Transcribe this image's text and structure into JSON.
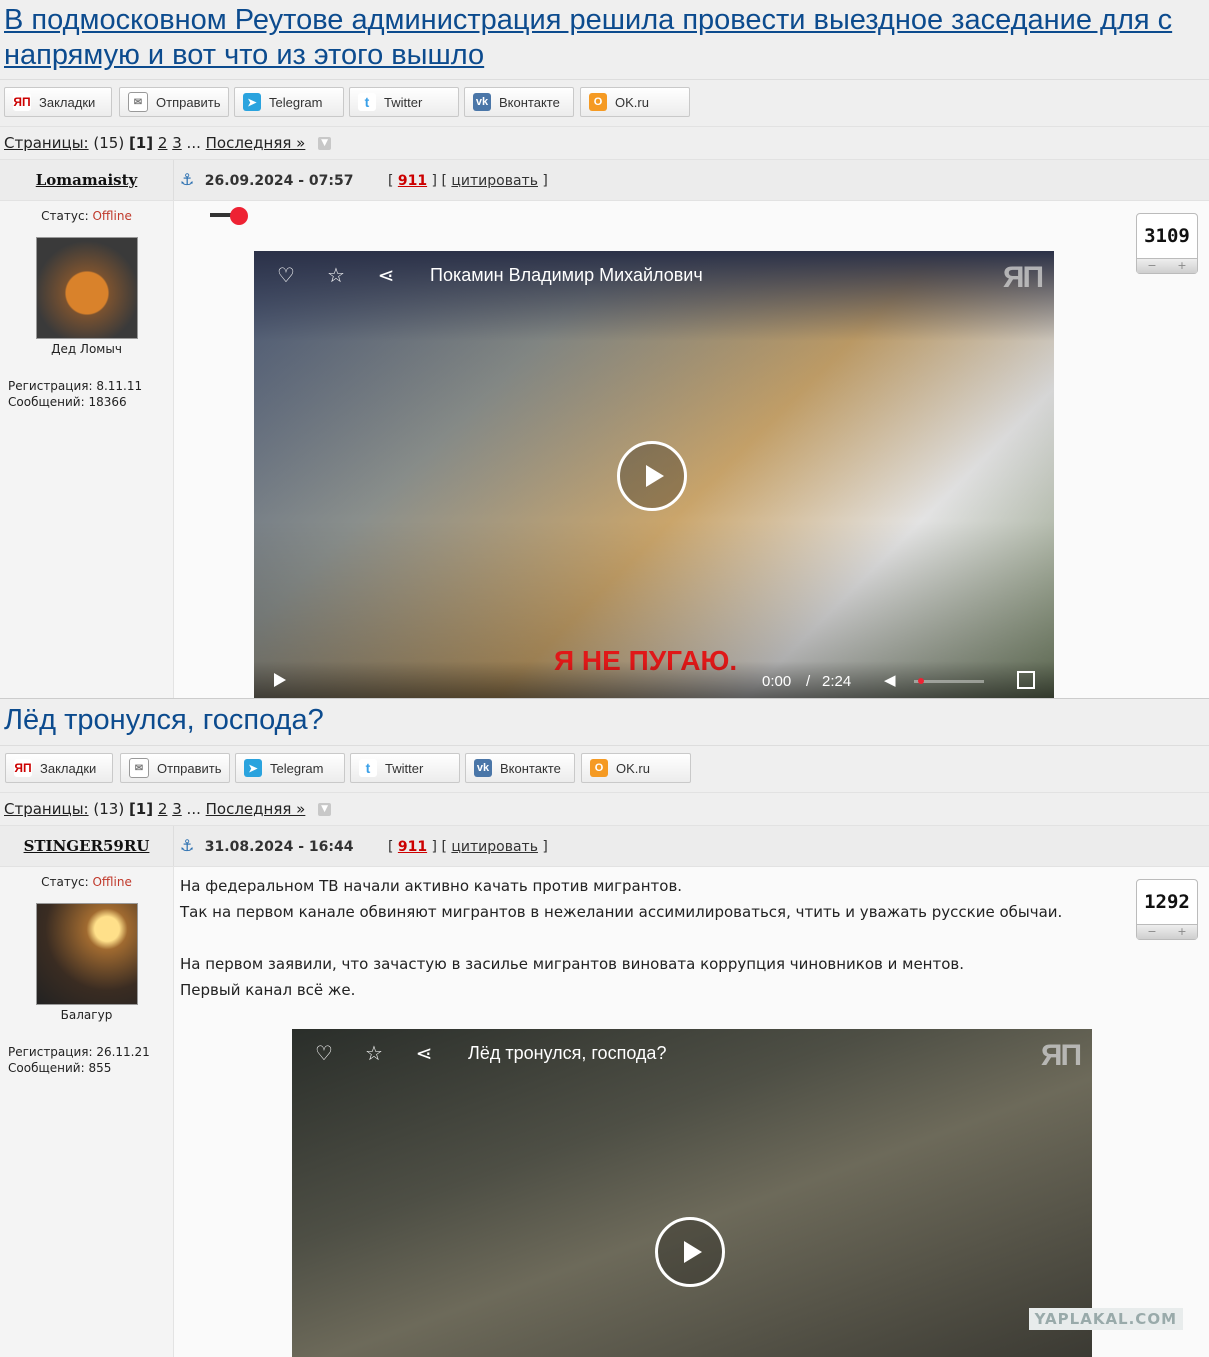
{
  "share_buttons": [
    {
      "label": "Закладки",
      "icon": "yp-bookmark-icon"
    },
    {
      "label": "Отправить",
      "icon": "mail-icon"
    },
    {
      "label": "Telegram",
      "icon": "telegram-icon"
    },
    {
      "label": "Twitter",
      "icon": "twitter-icon"
    },
    {
      "label": "Вконтакте",
      "icon": "vk-icon"
    },
    {
      "label": "OK.ru",
      "icon": "ok-icon"
    }
  ],
  "topics": [
    {
      "title": "В подмосковном Реутове администрация решила провести выездное заседание для с напрямую и вот что из этого вышло",
      "pages_label": "Страницы:",
      "pages_count": "(15)",
      "current_page": "[1]",
      "page_links": [
        "2",
        "3"
      ],
      "ellipsis": "...",
      "last_label": "Последняя »",
      "post": {
        "author": "Lomamaisty",
        "date": "26.09.2024 - 07:57",
        "post_number": "911",
        "quote_label": "цитировать",
        "status_label": "Статус:",
        "status_value": "Offline",
        "avatar_caption": "Дед Ломыч",
        "registration": "Регистрация: 8.11.11",
        "messages": "Сообщений: 18366",
        "rating": "3109",
        "video": {
          "title": "Покамин Владимир Михайлович",
          "time_current": "0:00",
          "time_total": "2:24",
          "caption": "Я НЕ ПУГАЮ."
        }
      }
    },
    {
      "title": "Лёд тронулся, господа?",
      "pages_label": "Страницы:",
      "pages_count": "(13)",
      "current_page": "[1]",
      "page_links": [
        "2",
        "3"
      ],
      "ellipsis": "...",
      "last_label": "Последняя »",
      "post": {
        "author": "STINGER59RU",
        "date": "31.08.2024 - 16:44",
        "post_number": "911",
        "quote_label": "цитировать",
        "status_label": "Статус:",
        "status_value": "Offline",
        "avatar_caption": "Балагур",
        "registration": "Регистрация: 26.11.21",
        "messages": "Сообщений: 855",
        "rating": "1292",
        "text_lines": [
          "На федеральном ТВ начали активно качать против мигрантов.",
          "Так на первом канале обвиняют мигрантов в нежелании ассимилироваться, чтить и уважать русские обычаи.",
          "",
          "На первом заявили, что зачастую в засилье мигрантов виновата коррупция чиновников и ментов.",
          "Первый канал всё же."
        ],
        "video": {
          "title": "Лёд тронулся, господа?"
        }
      }
    }
  ],
  "watermark": "YAPLAKAL.COM",
  "colors": {
    "title_link": "#0c4b8e",
    "offline": "#c0392b",
    "post_number": "#cc0000"
  }
}
